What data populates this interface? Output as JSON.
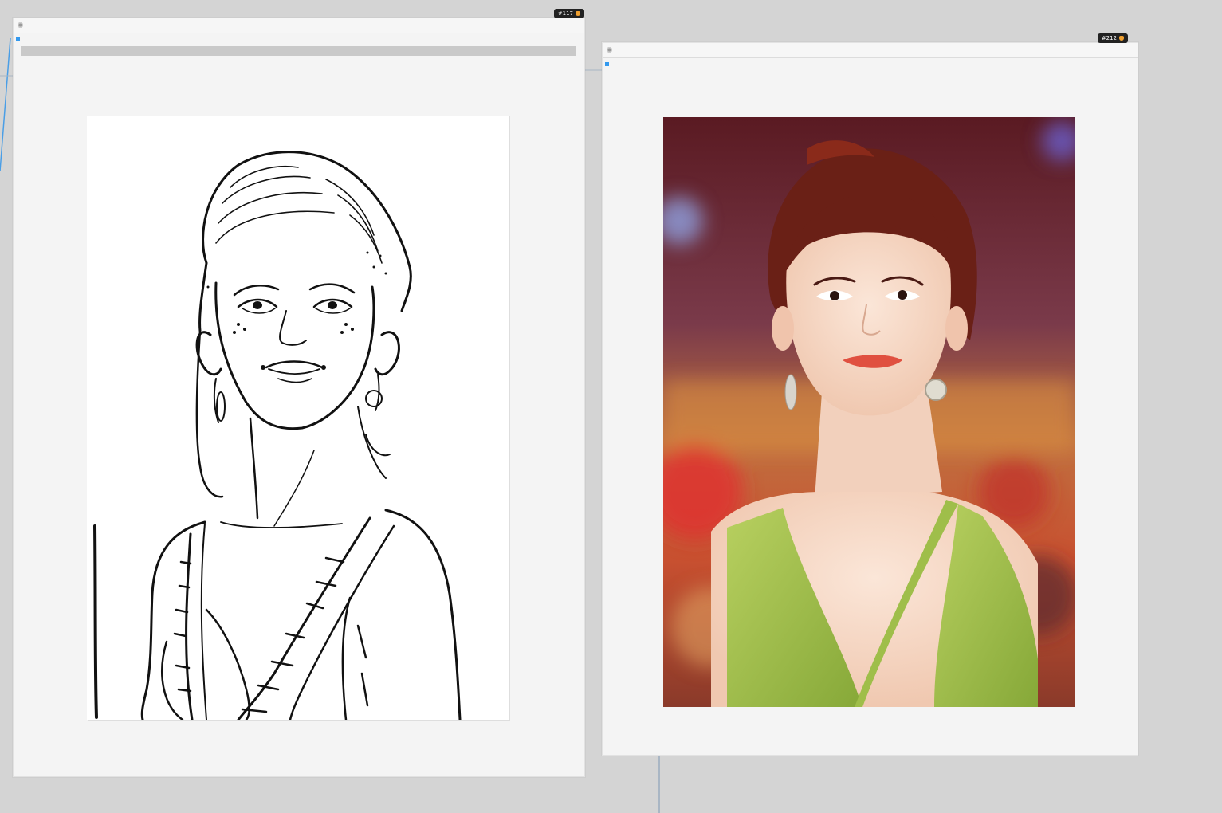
{
  "canvas": {
    "background": "#d4d4d4",
    "link_color": "#3399ee"
  },
  "nodes": [
    {
      "id_label": "#117",
      "badge_icon": "fox-icon",
      "output": "lineart-sketch-image",
      "progress": 1.0
    },
    {
      "id_label": "#212",
      "badge_icon": "fox-icon",
      "output": "photo-image"
    }
  ],
  "colors": {
    "node_body": "#f4f4f4",
    "badge_bg": "#222222",
    "badge_icon": "#f0a030",
    "dress": "#9cc04a",
    "hair": "#7a2418",
    "lips": "#e05040"
  }
}
